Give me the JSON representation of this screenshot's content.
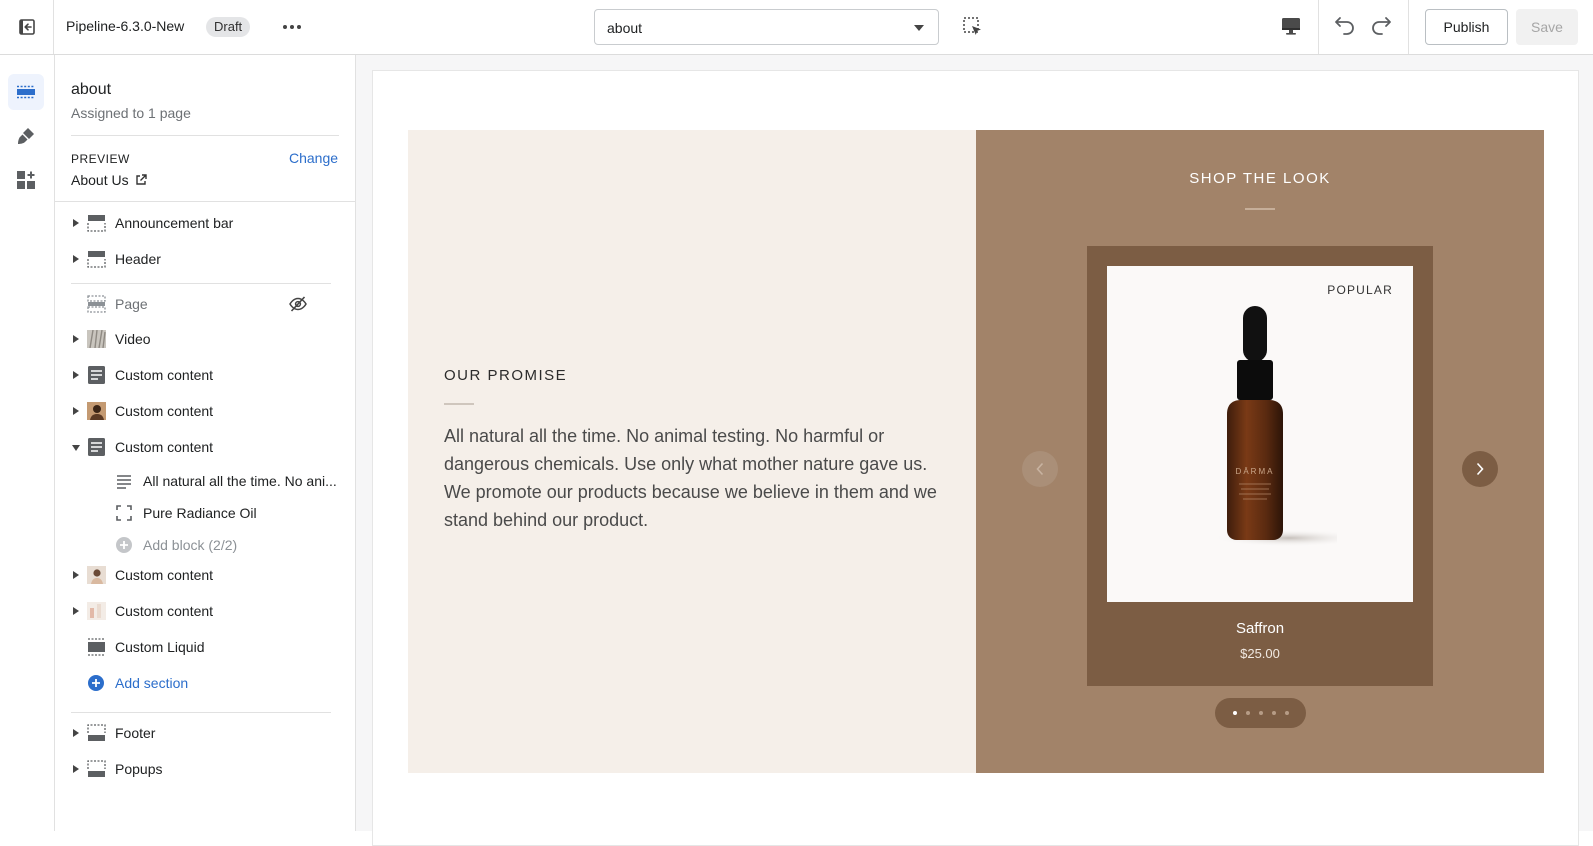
{
  "topbar": {
    "theme_name": "Pipeline-6.3.0-New",
    "status_badge": "Draft",
    "template_select_value": "about",
    "publish_label": "Publish",
    "save_label": "Save"
  },
  "sidebar": {
    "template_title": "about",
    "assigned_text": "Assigned to 1 page",
    "preview_label": "PREVIEW",
    "change_label": "Change",
    "preview_page": "About Us",
    "header_group": [
      {
        "label": "Announcement bar",
        "icon": "section-icon"
      },
      {
        "label": "Header",
        "icon": "section-icon"
      }
    ],
    "template_group": [
      {
        "label": "Page",
        "icon": "section-icon",
        "hidden": true
      },
      {
        "label": "Video",
        "icon": "image-thumbnail"
      },
      {
        "label": "Custom content",
        "icon": "text-icon"
      },
      {
        "label": "Custom content",
        "icon": "image-thumbnail"
      },
      {
        "label": "Custom content",
        "icon": "text-icon",
        "expanded": true
      }
    ],
    "blocks": [
      {
        "label": "All natural all the time. No ani...",
        "icon": "text-lines-icon"
      },
      {
        "label": "Pure Radiance Oil",
        "icon": "product-frame-icon"
      },
      {
        "label": "Add block (2/2)",
        "icon": "add-circle-icon"
      }
    ],
    "template_group_after": [
      {
        "label": "Custom content",
        "icon": "image-thumbnail"
      },
      {
        "label": "Custom content",
        "icon": "image-thumbnail"
      },
      {
        "label": "Custom Liquid",
        "icon": "section-icon"
      }
    ],
    "add_section_label": "Add section",
    "footer_group": [
      {
        "label": "Footer",
        "icon": "section-icon"
      },
      {
        "label": "Popups",
        "icon": "section-icon"
      }
    ]
  },
  "preview": {
    "promise_heading": "OUR PROMISE",
    "promise_text": "All natural all the time. No animal testing. No harmful or dangerous chemicals. Use only what mother nature gave us. We promote our products because we believe in them and we stand behind our product.",
    "shop_heading": "SHOP THE LOOK",
    "badge": "POPULAR",
    "product_name": "Saffron",
    "product_price": "$25.00",
    "bottle_brand": "DĀRMA",
    "slider_dots": 5,
    "active_dot": 1
  },
  "colors": {
    "accent": "#2c6ecb",
    "promise_bg": "#f5efe9",
    "shop_bg": "#a28369",
    "card_bg": "#7c5d44"
  }
}
